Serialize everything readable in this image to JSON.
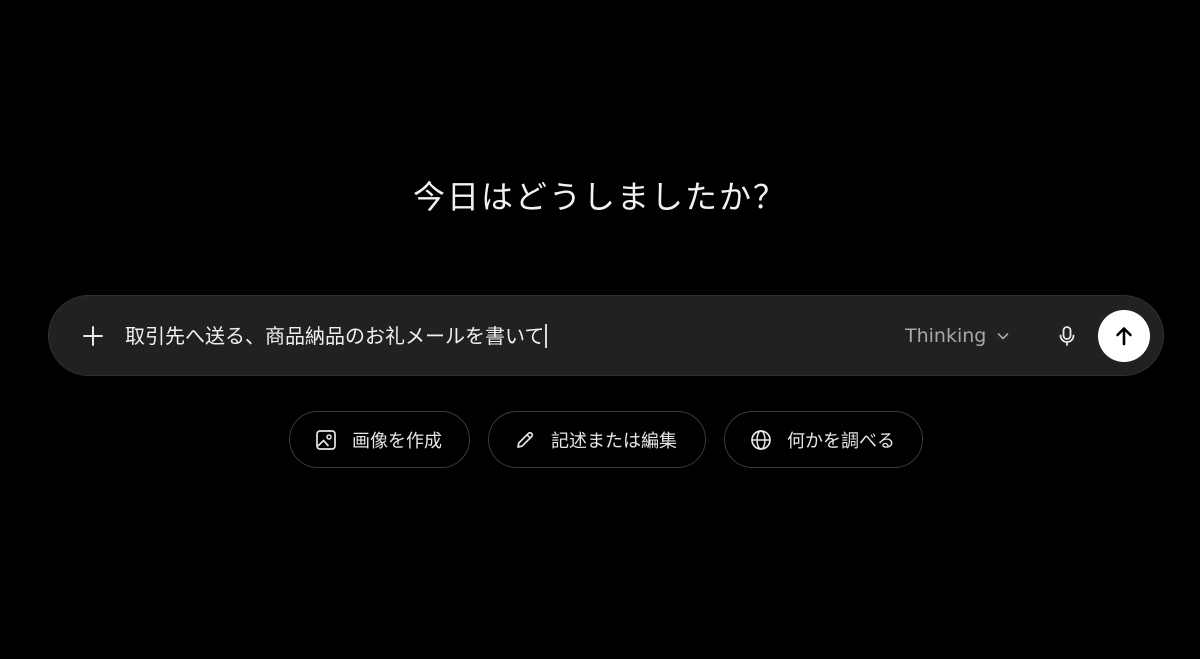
{
  "greeting": "今日はどうしましたか？",
  "composer": {
    "input_value": "取引先へ送る、商品納品のお礼メールを書いて",
    "model_label": "Thinking",
    "icons": {
      "add": "plus-icon",
      "model_dropdown": "chevron-down-icon",
      "voice": "microphone-icon",
      "send": "arrow-up-icon"
    }
  },
  "suggestions": [
    {
      "label": "画像を作成",
      "icon": "image-icon"
    },
    {
      "label": "記述または編集",
      "icon": "pencil-icon"
    },
    {
      "label": "何かを調べる",
      "icon": "globe-icon"
    }
  ],
  "colors": {
    "background": "#000000",
    "composer_background": "#212121",
    "send_button": "#ffffff"
  }
}
